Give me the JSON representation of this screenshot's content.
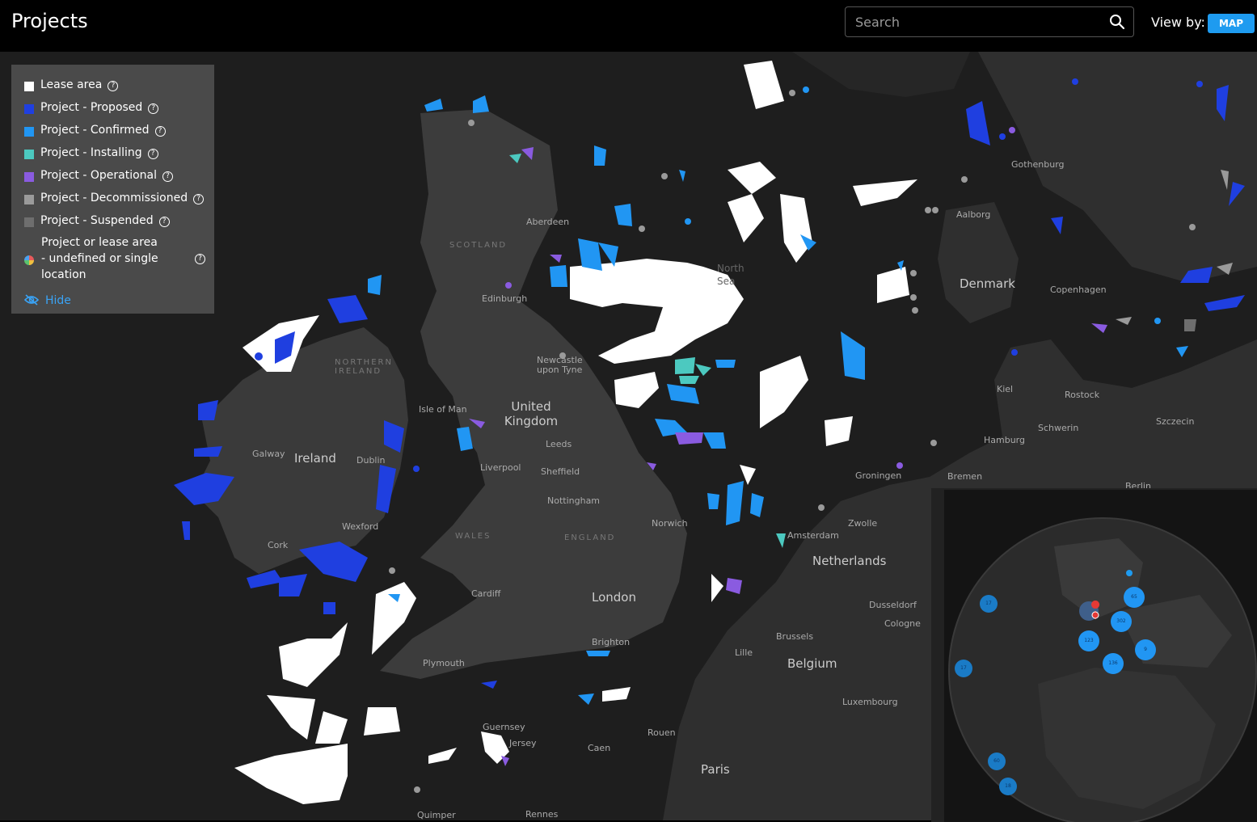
{
  "header": {
    "title": "Projects",
    "search_placeholder": "Search",
    "view_by_label": "View by:",
    "view_mode": "MAP"
  },
  "legend": {
    "items": [
      {
        "label": "Lease area",
        "color": "#ffffff"
      },
      {
        "label": "Project - Proposed",
        "color": "#1f3fe0"
      },
      {
        "label": "Project - Confirmed",
        "color": "#2196f3"
      },
      {
        "label": "Project - Installing",
        "color": "#4cc9c0"
      },
      {
        "label": "Project - Operational",
        "color": "#8a5be0"
      },
      {
        "label": "Project - Decommissioned",
        "color": "#9a9a9a"
      },
      {
        "label": "Project - Suspended",
        "color": "#6e6e6e"
      }
    ],
    "multi_label": "Project or lease area - undefined or single location",
    "hide_label": "Hide"
  },
  "map": {
    "labels": {
      "aberdeen": "Aberdeen",
      "scotland": "SCOTLAND",
      "edinburgh": "Edinburgh",
      "northern_ireland": "NORTHERN IRELAND",
      "newcastle": "Newcastle upon Tyne",
      "isle_of_man": "Isle of Man",
      "uk": "United Kingdom",
      "leeds": "Leeds",
      "liverpool": "Liverpool",
      "sheffield": "Sheffield",
      "nottingham": "Nottingham",
      "galway": "Galway",
      "ireland": "Ireland",
      "dublin": "Dublin",
      "wexford": "Wexford",
      "cork": "Cork",
      "wales": "WALES",
      "england": "ENGLAND",
      "norwich": "Norwich",
      "cardiff": "Cardiff",
      "london": "London",
      "brighton": "Brighton",
      "plymouth": "Plymouth",
      "guernsey": "Guernsey",
      "jersey": "Jersey",
      "rouen": "Rouen",
      "caen": "Caen",
      "paris": "Paris",
      "quimper": "Quimper",
      "rennes": "Rennes",
      "lille": "Lille",
      "brussels": "Brussels",
      "belgium": "Belgium",
      "luxembourg": "Luxembourg",
      "amsterdam": "Amsterdam",
      "netherlands": "Netherlands",
      "zwolle": "Zwolle",
      "groningen": "Groningen",
      "dusseldorf": "Dusseldorf",
      "cologne": "Cologne",
      "north_sea": "North Sea",
      "denmark": "Denmark",
      "copenhagen": "Copenhagen",
      "aalborg": "Aalborg",
      "gothenburg": "Gothenburg",
      "kiel": "Kiel",
      "rostock": "Rostock",
      "hamburg": "Hamburg",
      "schwerin": "Schwerin",
      "szczecin": "Szczecin",
      "bremen": "Bremen",
      "berlin": "Berlin"
    }
  },
  "minimap": {
    "clusters": [
      "65",
      "302",
      "123",
      "9",
      "136",
      "17",
      "17",
      "60",
      "18"
    ]
  }
}
